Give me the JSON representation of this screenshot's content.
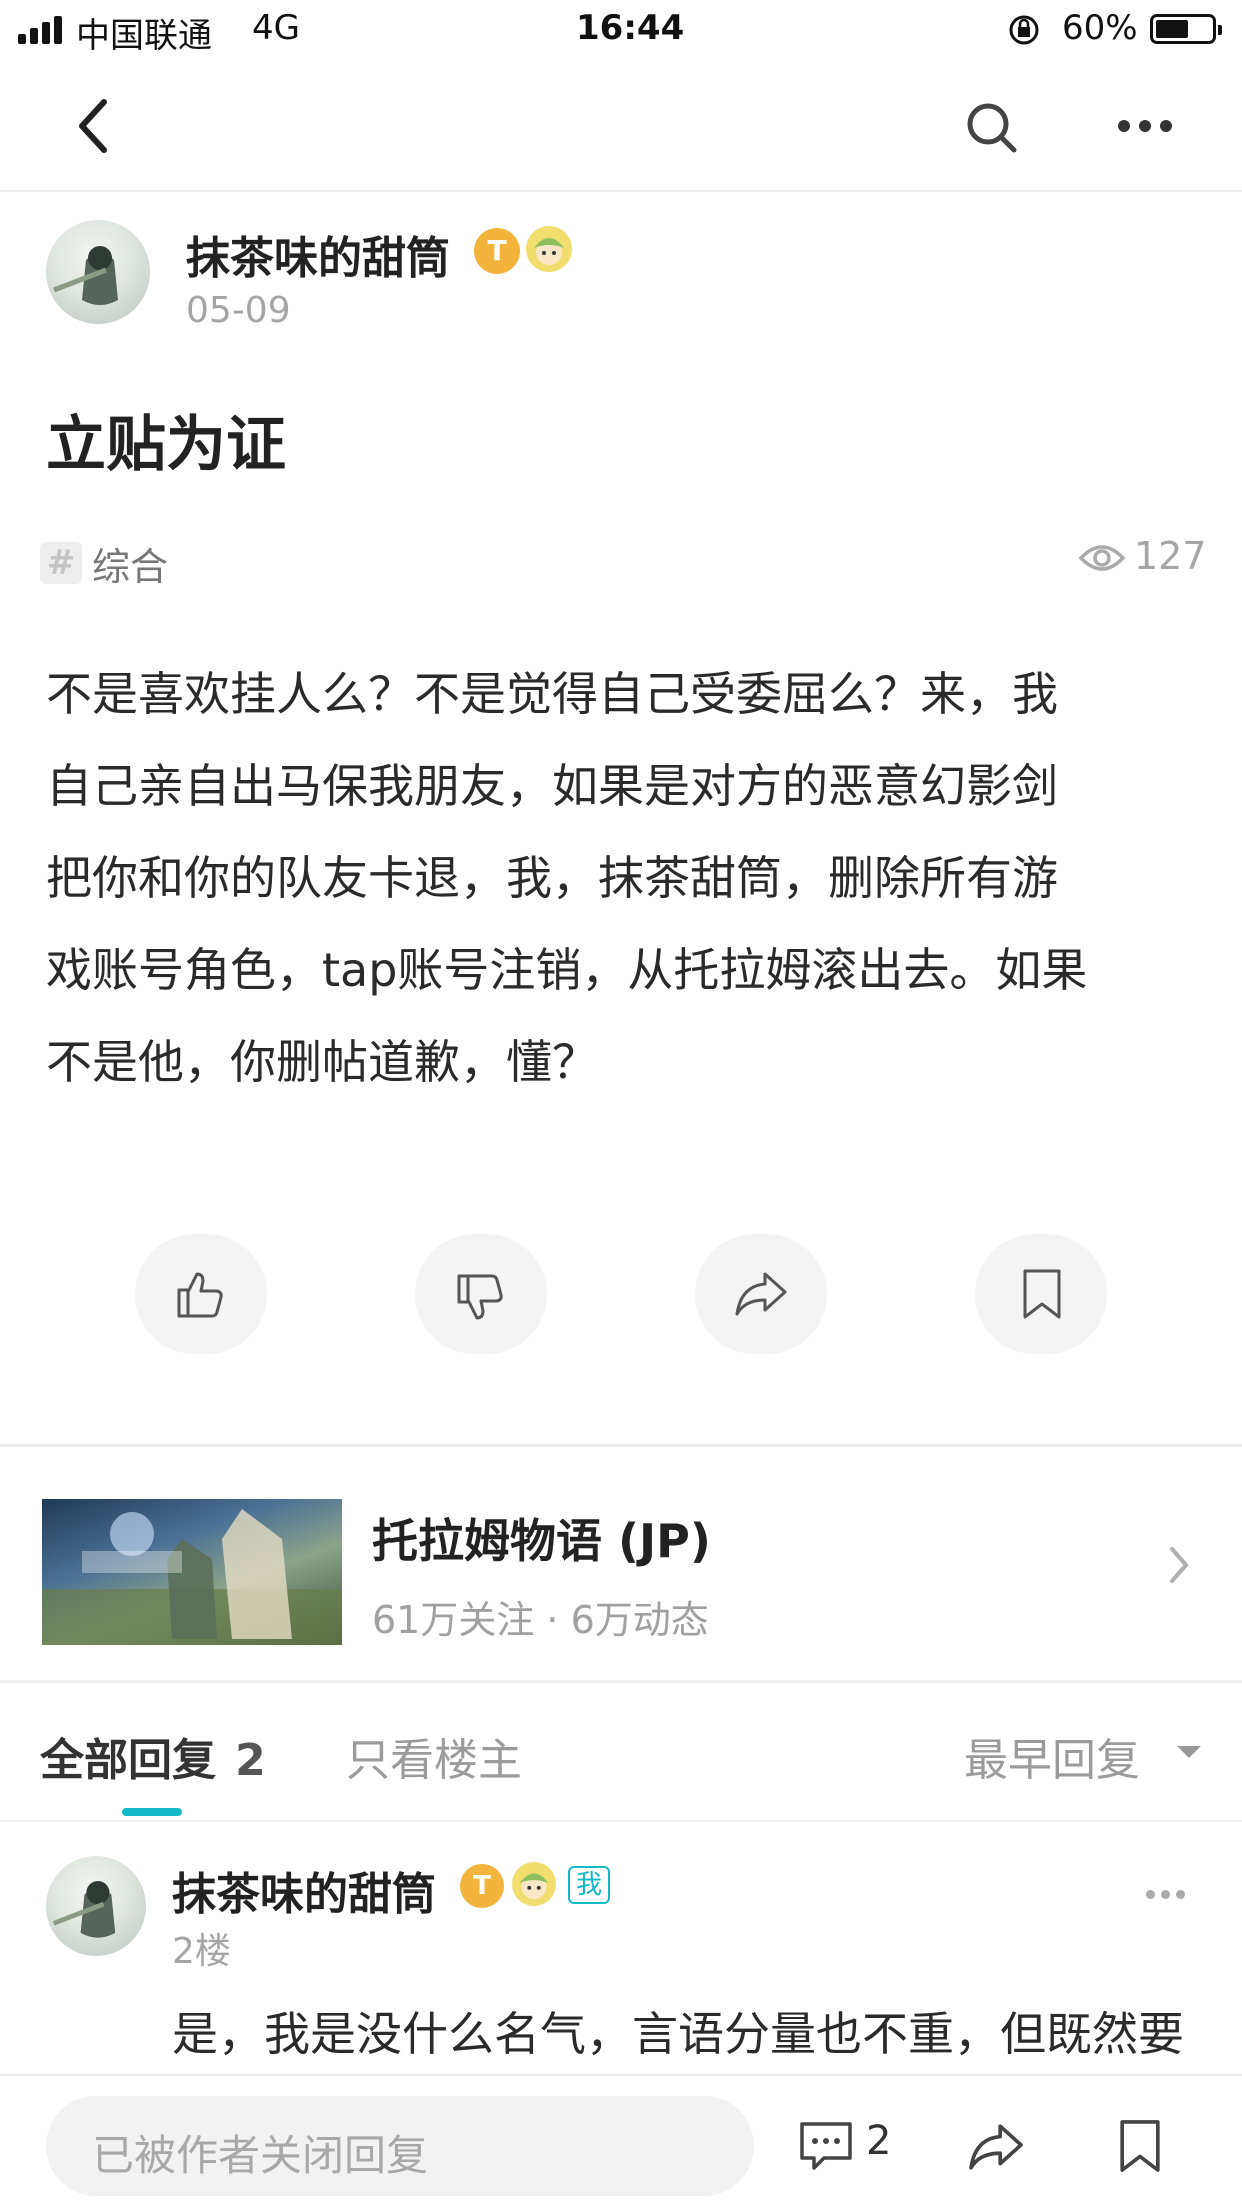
{
  "status_bar": {
    "carrier": "中国联通",
    "network": "4G",
    "time": "16:44",
    "battery_percent": "60%",
    "battery_level": 0.6
  },
  "nav": {
    "back_icon": "chevron-left-icon",
    "search_icon": "search-icon",
    "more_icon": "more-horizontal-icon"
  },
  "post": {
    "author": "抹茶味的甜筒",
    "date": "05-09",
    "title": "立贴为证",
    "tag_icon": "hashtag-icon",
    "tag": "综合",
    "views": "127",
    "body_lines": [
      "不是喜欢挂人么？不是觉得自己受委屈么？来，我",
      "自己亲自出马保我朋友，如果是对方的恶意幻影剑",
      "把你和你的队友卡退，我，抹茶甜筒，删除所有游",
      "戏账号角色，tap账号注销，从托拉姆滚出去。如果",
      "不是他，你删帖道歉，懂？"
    ]
  },
  "actions": {
    "like_icon": "thumbs-up-icon",
    "dislike_icon": "thumbs-down-icon",
    "share_icon": "share-icon",
    "bookmark_icon": "bookmark-icon"
  },
  "game_card": {
    "name": "托拉姆物语 (JP)",
    "stats": "61万关注 · 6万动态",
    "chevron_icon": "chevron-right-icon"
  },
  "replies": {
    "tab_all": "全部回复",
    "tab_all_count": "2",
    "tab_op_only": "只看楼主",
    "sort_label": "最早回复",
    "first_reply": {
      "author": "抹茶味的甜筒",
      "me_badge": "我",
      "floor": "2楼",
      "text_line1": "是，我是没什么名气，言语分量也不重，但既然要"
    }
  },
  "bottom_bar": {
    "input_placeholder": "已被作者关闭回复",
    "comment_count": "2",
    "colors": {
      "accent": "#14b9c8",
      "text_gray": "#9b9b9b"
    }
  }
}
